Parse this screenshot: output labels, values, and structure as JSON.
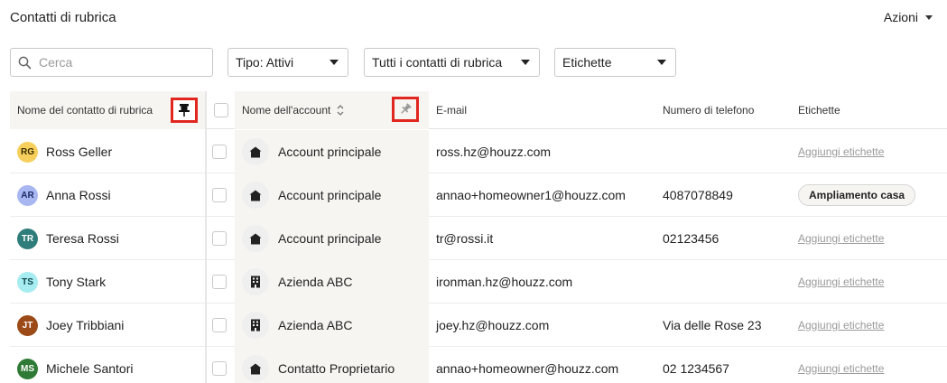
{
  "page": {
    "title": "Contatti di rubrica",
    "actions_label": "Azioni"
  },
  "filters": {
    "search_placeholder": "Cerca",
    "type": "Tipo: Attivi",
    "contacts": "Tutti i contatti di rubrica",
    "tags": "Etichette"
  },
  "columns": {
    "name": "Nome del contatto di rubrica",
    "account": "Nome dell'account",
    "email": "E-mail",
    "phone": "Numero di telefono",
    "tags": "Etichette"
  },
  "add_tags_label": "Aggiungi etichette",
  "colors": {
    "highlight": "#e0261f",
    "avatar_rg": "#f6cf5d",
    "avatar_ar": "#a8b7f1",
    "avatar_tr": "#2e7d7a",
    "avatar_ts": "#a6ecf0",
    "avatar_jt": "#9c4a17",
    "avatar_ms": "#2f7a34"
  },
  "rows": [
    {
      "initials": "RG",
      "name": "Ross Geller",
      "account": "Account principale",
      "account_icon": "house-icon",
      "email": "ross.hz@houzz.com",
      "phone": "",
      "tag": ""
    },
    {
      "initials": "AR",
      "name": "Anna Rossi",
      "account": "Account principale",
      "account_icon": "house-icon",
      "email": "annao+homeowner1@houzz.com",
      "phone": "4087078849",
      "tag": "Ampliamento casa"
    },
    {
      "initials": "TR",
      "name": "Teresa Rossi",
      "account": "Account principale",
      "account_icon": "house-icon",
      "email": "tr@rossi.it",
      "phone": "02123456",
      "tag": ""
    },
    {
      "initials": "TS",
      "name": "Tony Stark",
      "account": "Azienda ABC",
      "account_icon": "building-icon",
      "email": "ironman.hz@houzz.com",
      "phone": "",
      "tag": ""
    },
    {
      "initials": "JT",
      "name": "Joey Tribbiani",
      "account": "Azienda ABC",
      "account_icon": "building-icon",
      "email": "joey.hz@houzz.com",
      "phone": "Via delle Rose 23",
      "tag": ""
    },
    {
      "initials": "MS",
      "name": "Michele Santori",
      "account": "Contatto Proprietario",
      "account_icon": "house-icon",
      "email": "annao+homeowner@houzz.com",
      "phone": "02 1234567",
      "tag": ""
    }
  ]
}
